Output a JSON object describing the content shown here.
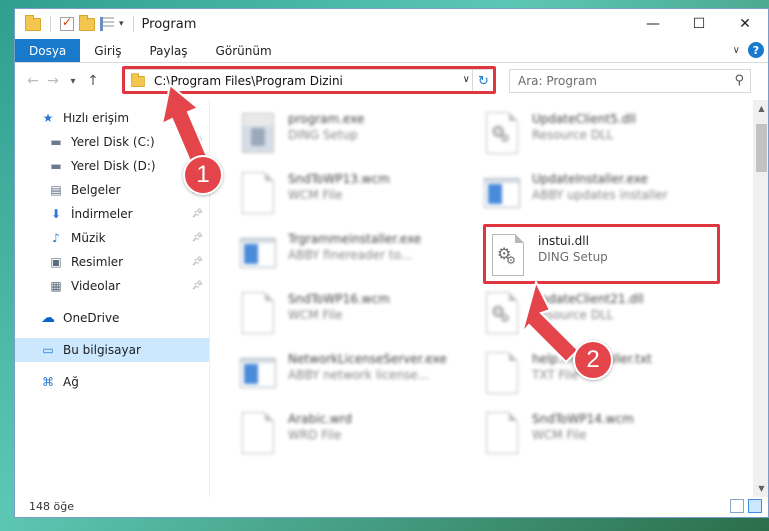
{
  "window": {
    "title": "Program",
    "controls": {
      "minimize": "—",
      "maximize": "☐",
      "close": "✕"
    }
  },
  "ribbon": {
    "tabs": [
      {
        "label": "Dosya",
        "active": true
      },
      {
        "label": "Giriş"
      },
      {
        "label": "Paylaş"
      },
      {
        "label": "Görünüm"
      }
    ]
  },
  "nav": {
    "back": "←",
    "forward": "→",
    "recent": "▾",
    "up": "↑",
    "address": "C:\\Program Files\\Program Dizini",
    "search_placeholder": "Ara: Program"
  },
  "sidebar": {
    "items": [
      {
        "label": "Hızlı erişim",
        "icon": "star-icon",
        "glyph": "★",
        "pinned": false
      },
      {
        "label": "Yerel Disk (C:)",
        "icon": "drive-icon",
        "glyph": "▬",
        "pinned": true
      },
      {
        "label": "Yerel Disk (D:)",
        "icon": "drive-icon",
        "glyph": "▬",
        "pinned": false
      },
      {
        "label": "Belgeler",
        "icon": "documents-icon",
        "glyph": "▤",
        "pinned": true
      },
      {
        "label": "İndirmeler",
        "icon": "download-icon",
        "glyph": "⬇",
        "pinned": true
      },
      {
        "label": "Müzik",
        "icon": "music-icon",
        "glyph": "♪",
        "pinned": true
      },
      {
        "label": "Resimler",
        "icon": "pictures-icon",
        "glyph": "▣",
        "pinned": true
      },
      {
        "label": "Videolar",
        "icon": "video-icon",
        "glyph": "▦",
        "pinned": true
      },
      {
        "label": "OneDrive",
        "icon": "cloud-icon",
        "glyph": "☁"
      },
      {
        "label": "Bu bilgisayar",
        "icon": "computer-icon",
        "glyph": "▭",
        "selected": true
      },
      {
        "label": "Ağ",
        "icon": "network-icon",
        "glyph": "⌘"
      }
    ]
  },
  "files": [
    {
      "name": "program.exe",
      "desc": "DING Setup",
      "icon": "exe-icon",
      "blurred": true
    },
    {
      "name": "UpdateClient5.dll",
      "desc": "Resource DLL",
      "icon": "dll-icon",
      "blurred": true
    },
    {
      "name": "SndToWP13.wcm",
      "desc": "WCM File",
      "icon": "file-icon",
      "blurred": true
    },
    {
      "name": "UpdateInstaller.exe",
      "desc": "ABBY updates installer",
      "icon": "window-icon",
      "blurred": true
    },
    {
      "name": "Trgrammeinstaller.exe",
      "desc": "ABBY finereader to...",
      "icon": "window-icon",
      "blurred": true
    },
    {
      "name": "instui.dll",
      "desc": "DING Setup",
      "icon": "dll-icon",
      "blurred": false
    },
    {
      "name": "SndToWP16.wcm",
      "desc": "WCM File",
      "icon": "file-icon",
      "blurred": true
    },
    {
      "name": "UpdateClient21.dll",
      "desc": "Resource DLL",
      "icon": "dll-icon",
      "blurred": true
    },
    {
      "name": "NetworkLicenseServer.exe",
      "desc": "ABBY network license...",
      "icon": "window-icon",
      "blurred": true
    },
    {
      "name": "help.fineinstaller.txt",
      "desc": "TXT File",
      "icon": "file-icon",
      "blurred": true
    },
    {
      "name": "Arabic.wrd",
      "desc": "WRD File",
      "icon": "file-icon",
      "blurred": true
    },
    {
      "name": "SndToWP14.wcm",
      "desc": "WCM File",
      "icon": "file-icon",
      "blurred": true
    }
  ],
  "status": {
    "count": "148 öğe"
  },
  "callouts": {
    "one": "1",
    "two": "2"
  },
  "colors": {
    "accent": "#1979ca",
    "highlight": "#e0363f",
    "callout": "#e4454b"
  }
}
